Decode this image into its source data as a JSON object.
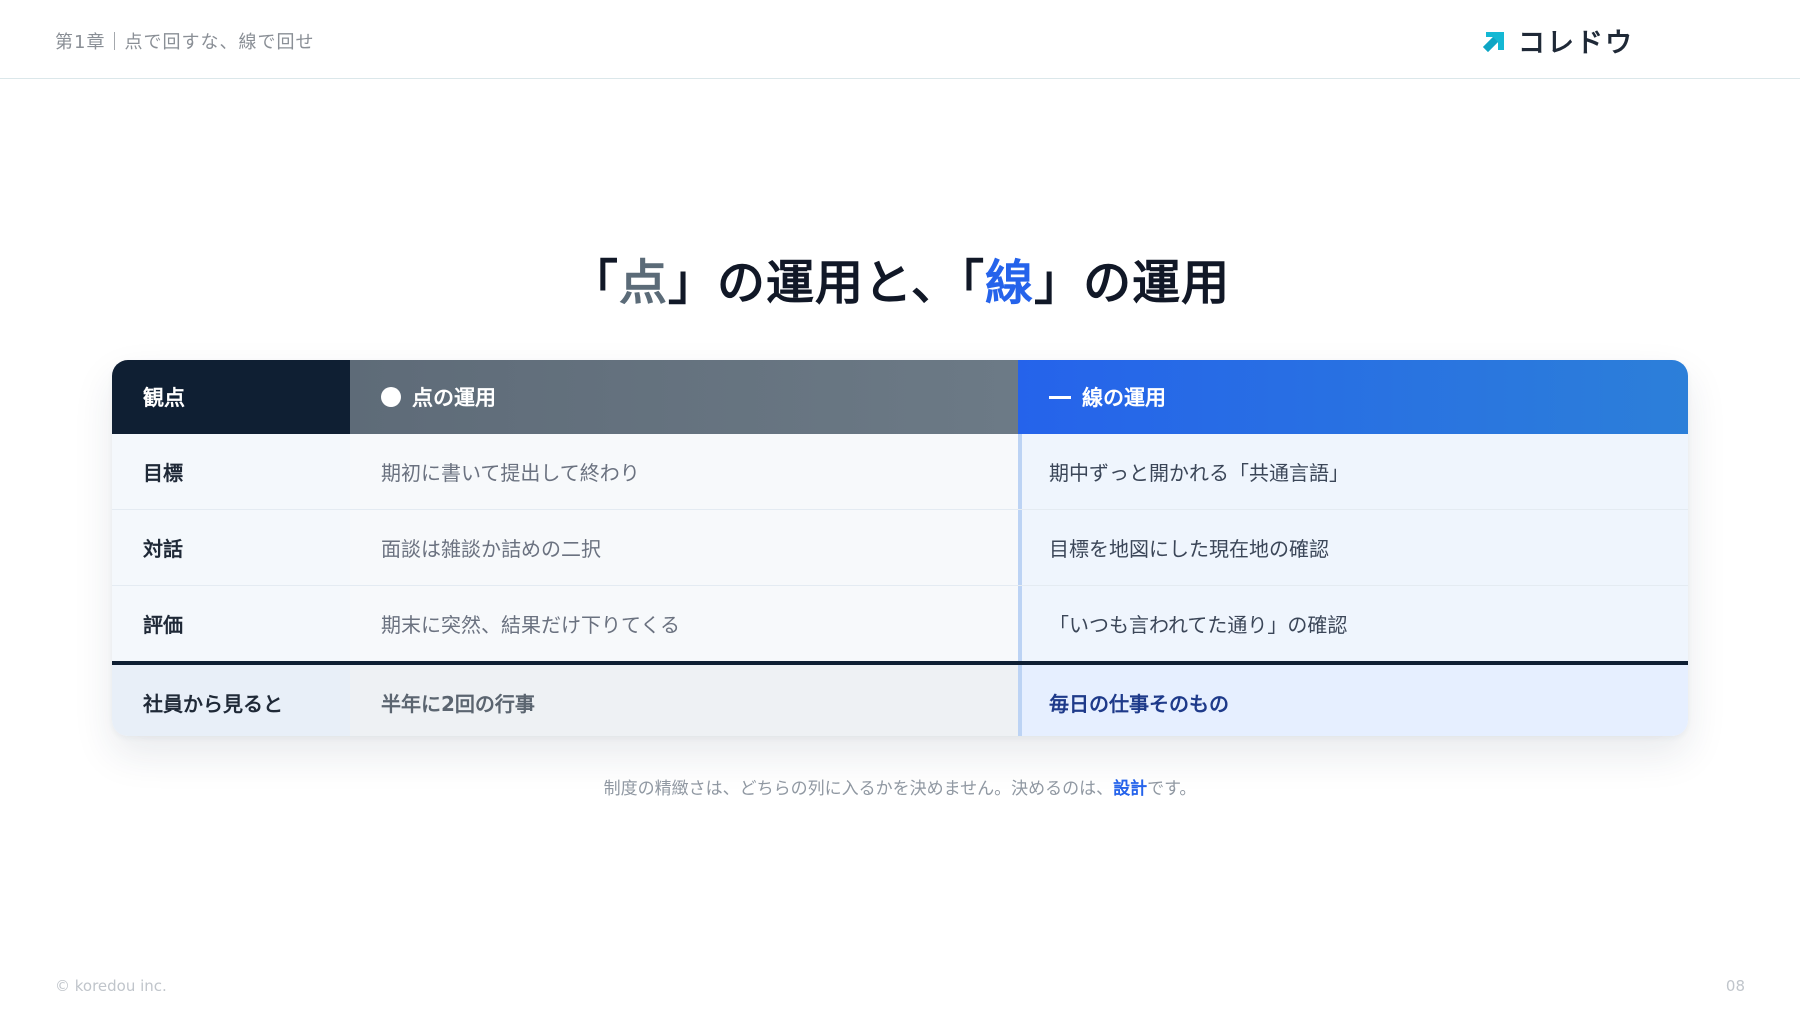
{
  "header": {
    "chapter": "第1章｜点で回すな、線で回せ",
    "logo_text": "コレドウ"
  },
  "title": {
    "open1": "「",
    "point": "点",
    "mid": "」の運用と、「",
    "line": "線",
    "close": "」の運用"
  },
  "table": {
    "headers": [
      "観点",
      "点の運用",
      "線の運用"
    ],
    "rows": [
      {
        "label": "目標",
        "point": "期初に書いて提出して終わり",
        "line": "期中ずっと開かれる「共通言語」"
      },
      {
        "label": "対話",
        "point": "面談は雑談か詰めの二択",
        "line": "目標を地図にした現在地の確認"
      },
      {
        "label": "評価",
        "point": "期末に突然、結果だけ下りてくる",
        "line": "「いつも言われてた通り」の確認"
      }
    ],
    "summary": {
      "label": "社員から見ると",
      "point": "半年に2回の行事",
      "line": "毎日の仕事そのもの"
    }
  },
  "note": {
    "before": "制度の精緻さは、どちらの列に入るかを決めません。決めるのは、",
    "emph": "設計",
    "after": "です。"
  },
  "footer": {
    "copyright": "© koredou inc.",
    "page": "08"
  },
  "colors": {
    "accent_blue": "#2563eb",
    "point_gray": "#5b6b78",
    "navy": "#0f1f33",
    "logo_teal": "#14b8d4"
  },
  "icons": {
    "logo": "arrow-up-right-icon",
    "point_header": "dot-icon",
    "line_header": "dash-icon"
  }
}
